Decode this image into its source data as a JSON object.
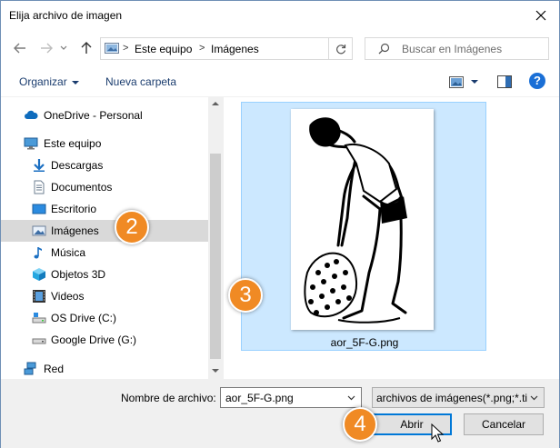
{
  "window": {
    "title": "Elija archivo de imagen"
  },
  "address": {
    "crumbs": [
      "Este equipo",
      "Imágenes"
    ]
  },
  "search": {
    "placeholder": "Buscar en Imágenes"
  },
  "toolbar": {
    "organize": "Organizar",
    "new_folder": "Nueva carpeta",
    "help": "?"
  },
  "nav": {
    "items": [
      {
        "label": "OneDrive - Personal",
        "icon": "cloud-icon"
      },
      {
        "label": "Este equipo",
        "icon": "computer-icon"
      },
      {
        "label": "Descargas",
        "icon": "download-icon"
      },
      {
        "label": "Documentos",
        "icon": "document-icon"
      },
      {
        "label": "Escritorio",
        "icon": "desktop-icon"
      },
      {
        "label": "Imágenes",
        "icon": "pictures-icon",
        "selected": true
      },
      {
        "label": "Música",
        "icon": "music-icon"
      },
      {
        "label": "Objetos 3D",
        "icon": "cube-icon"
      },
      {
        "label": "Videos",
        "icon": "film-icon"
      },
      {
        "label": "OS Drive (C:)",
        "icon": "drive-icon"
      },
      {
        "label": "Google Drive (G:)",
        "icon": "drive-icon"
      },
      {
        "label": "Red",
        "icon": "network-icon"
      }
    ]
  },
  "content": {
    "file_name": "aor_5F-G.png"
  },
  "bottom": {
    "filename_label": "Nombre de archivo:",
    "filename_value": "aor_5F-G.png",
    "filter_value": "archivos de imágenes(*.png;*.ti",
    "open_button": "Abrir",
    "cancel_button": "Cancelar"
  },
  "annotations": {
    "step2": "2",
    "step3": "3",
    "step4": "4"
  },
  "colors": {
    "badge": "#f08a24",
    "selection": "#cce8ff",
    "accent": "#0078d7"
  }
}
